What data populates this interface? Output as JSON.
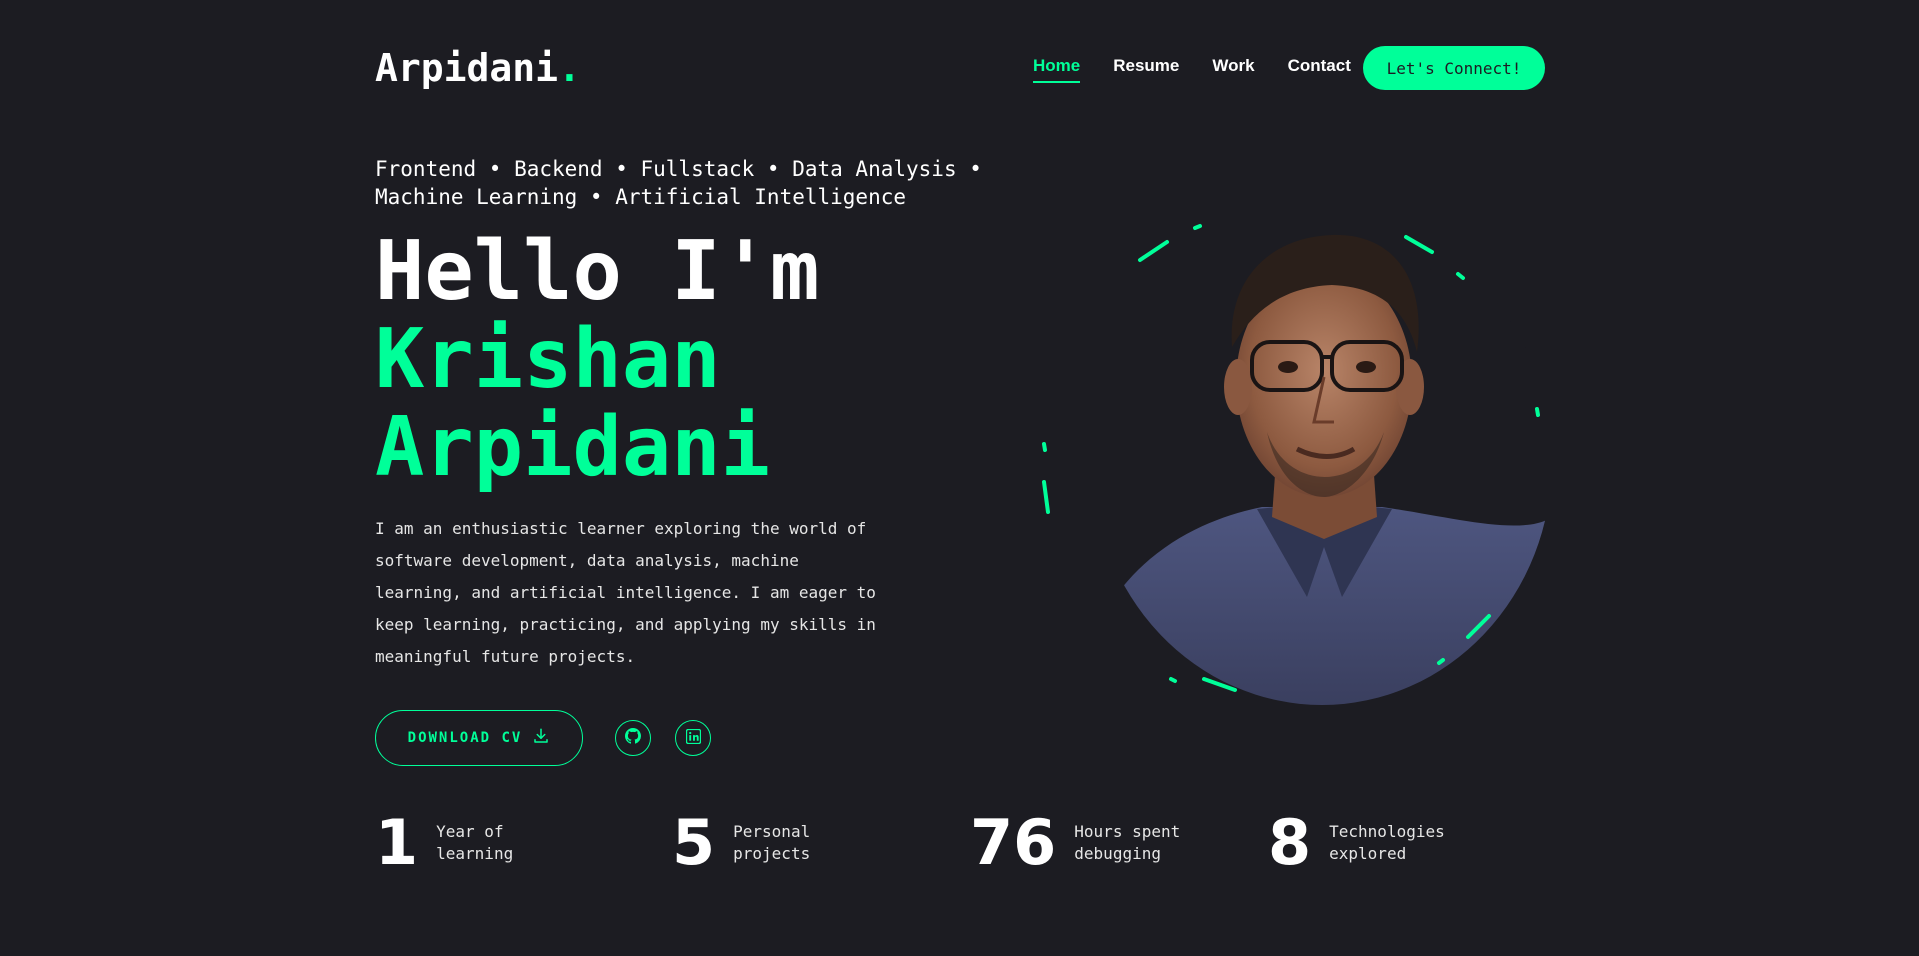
{
  "header": {
    "logo_text": "Arpidani",
    "logo_dot": ".",
    "nav": [
      {
        "label": "Home",
        "active": true
      },
      {
        "label": "Resume",
        "active": false
      },
      {
        "label": "Work",
        "active": false
      },
      {
        "label": "Contact",
        "active": false
      }
    ],
    "cta_label": "Let's Connect!"
  },
  "hero": {
    "roles_line1": "Frontend • Backend • Fullstack • Data Analysis •",
    "roles_line2": "Machine Learning • Artificial Intelligence",
    "greeting": "Hello I'm",
    "first_name": "Krishan",
    "last_name": "Arpidani",
    "bio": "I am an enthusiastic learner exploring the world of software development, data analysis, machine learning, and artificial intelligence. I am eager to keep learning, practicing, and applying my skills in meaningful future projects.",
    "download_label": "DOWNLOAD CV",
    "download_icon": "download-icon",
    "socials": [
      {
        "icon": "github-icon"
      },
      {
        "icon": "linkedin-icon"
      }
    ]
  },
  "stats": [
    {
      "value": "1",
      "label": "Year of learning"
    },
    {
      "value": "5",
      "label": "Personal projects"
    },
    {
      "value": "76",
      "label": "Hours spent debugging"
    },
    {
      "value": "8",
      "label": "Technologies explored"
    }
  ],
  "colors": {
    "background": "#1c1c22",
    "accent": "#00ff99",
    "text": "#ffffff"
  }
}
